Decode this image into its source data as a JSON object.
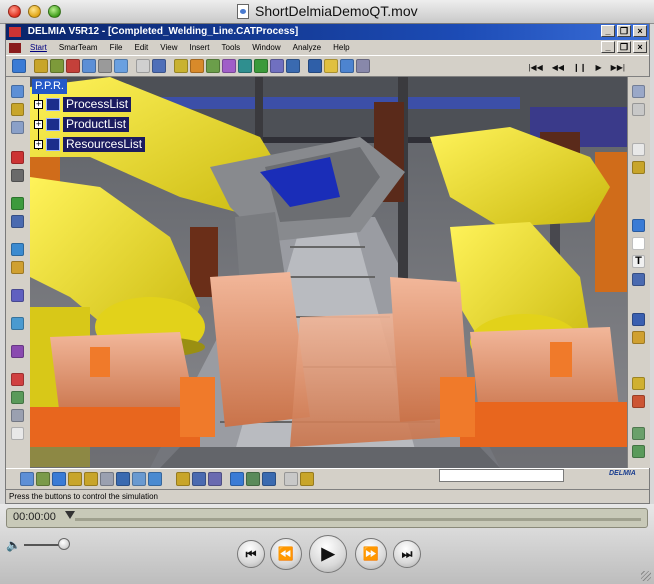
{
  "qt_window": {
    "title": "ShortDelmiaDemoQT.mov",
    "time": "00:00:00",
    "volume_fraction": 0.85,
    "playback_progress": 0.0
  },
  "app": {
    "title": "DELMIA V5R12 - [Completed_Welding_Line.CATProcess]",
    "menu": [
      "Start",
      "SmarTeam",
      "File",
      "Edit",
      "View",
      "Insert",
      "Tools",
      "Window",
      "Analyze",
      "Help"
    ],
    "active_menu": "Start",
    "window_controls": [
      "_",
      "❐",
      "×"
    ]
  },
  "tree": {
    "root": "P.P.R.",
    "items": [
      {
        "label": "ProcessList"
      },
      {
        "label": "ProductList"
      },
      {
        "label": "ResourcesList"
      }
    ]
  },
  "status_bar": {
    "message": "Press the buttons to control the simulation"
  },
  "sim_controls": [
    "|◀◀",
    "◀◀",
    "❙❙",
    "▶",
    "▶▶|"
  ],
  "delmia_logo": "DELMIA",
  "player_buttons": {
    "go_start": "⏮",
    "rewind": "⏪",
    "play": "▶",
    "fast_forward": "⏩",
    "go_end": "⏭"
  },
  "colors": {
    "robot_yellow": "#f2e21c",
    "fixture_orange": "#e8661e",
    "tree_highlight": "#2458c8",
    "title_blue": "#0a246a"
  }
}
